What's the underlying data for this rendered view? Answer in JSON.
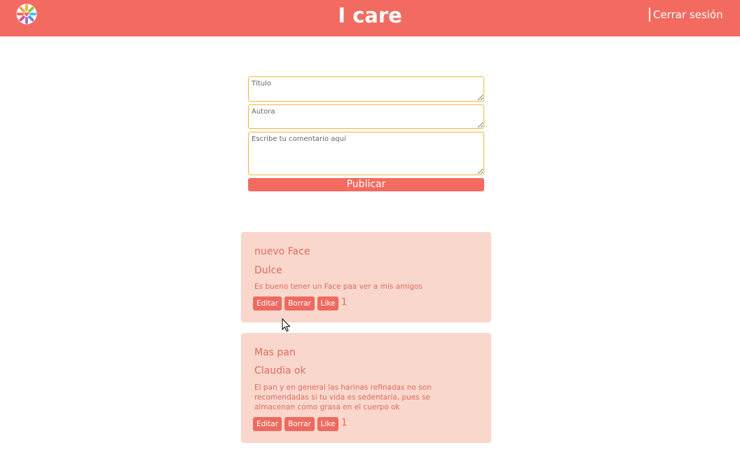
{
  "header": {
    "title": "I care",
    "logout_label": "Cerrar sesión",
    "bg_color": "#f36b60"
  },
  "form": {
    "title_placeholder": "Título",
    "author_placeholder": "Autora",
    "comment_placeholder": "Escribe tu comentario aquí",
    "publish_label": "Publicar"
  },
  "posts": [
    {
      "title": "nuevo Face",
      "author": "Dulce",
      "body": "Es bueno tener un Face paa ver a mis amigos",
      "edit_label": "Editar",
      "delete_label": "Borrar",
      "like_label": "Like",
      "likes": "1"
    },
    {
      "title": "Mas pan",
      "author": "Claudia ok",
      "body": "El pan y en general las harinas refinadas no son recomendadas si tu vida es sedentaria, pues se almacenan como grasa en el cuerpo ok",
      "edit_label": "Editar",
      "delete_label": "Borrar",
      "like_label": "Like",
      "likes": "1"
    }
  ],
  "colors": {
    "accent": "#f36b60",
    "card_bg": "#fad7cc",
    "field_border": "#f0b73a"
  }
}
